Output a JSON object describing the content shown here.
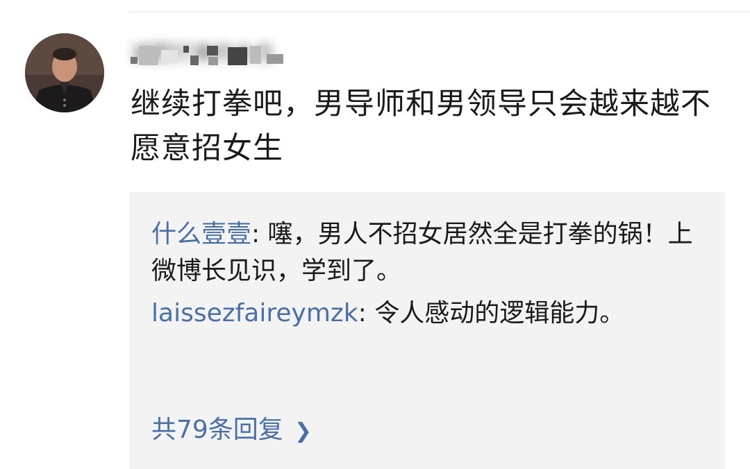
{
  "comment": {
    "username": "减肥打拳的女生",
    "text": "继续打拳吧，男导师和男领导只会越来越不愿意招女生"
  },
  "replies": [
    {
      "user": "什么壹壹",
      "separator": ": ",
      "text": "噻，男人不招女居然全是打拳的锅！上微博长见识，学到了。"
    },
    {
      "user": "laissezfaireymzk",
      "separator": ": ",
      "text": "令人感动的逻辑能力。"
    }
  ],
  "more_replies": {
    "label": "共79条回复",
    "icon": "chevron-right-icon"
  },
  "colors": {
    "link": "#4a6fa5",
    "reply_bg": "#f3f3f3",
    "text": "#1a1a1a"
  }
}
